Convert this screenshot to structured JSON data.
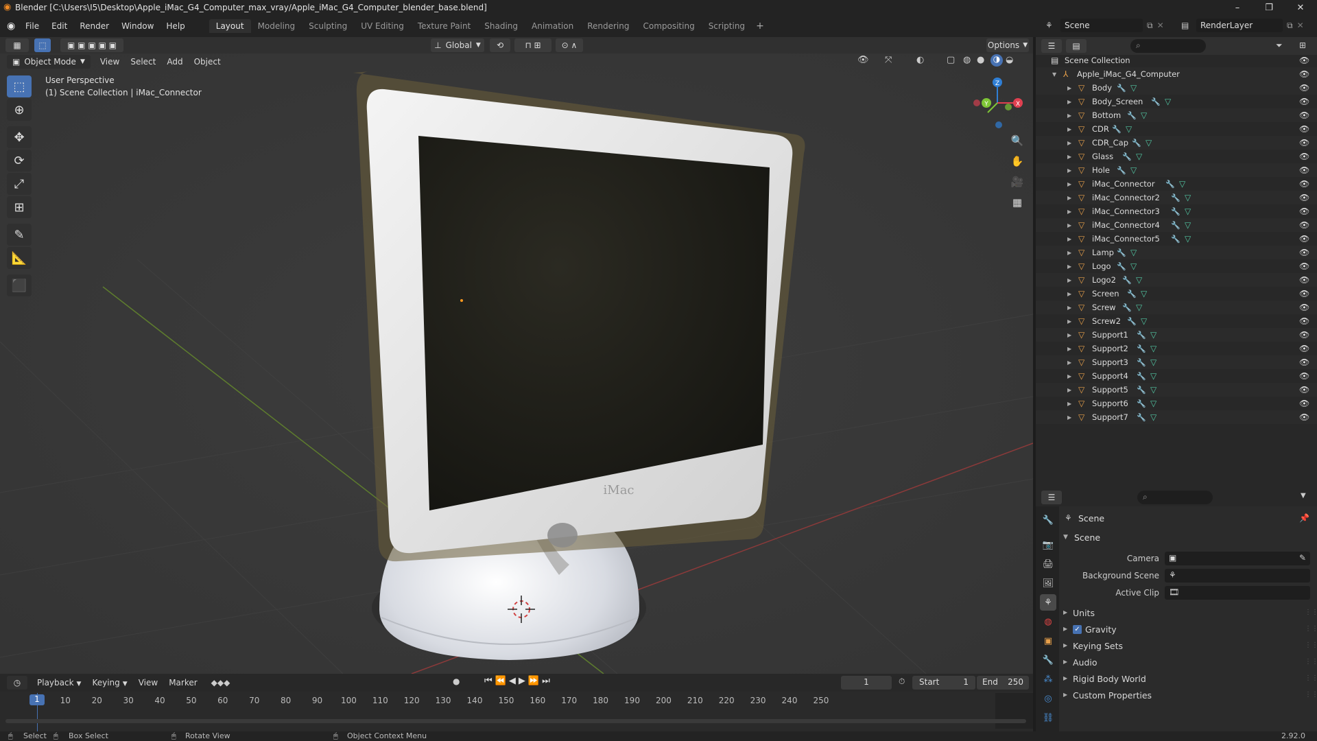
{
  "window": {
    "title": "Blender [C:\\Users\\I5\\Desktop\\Apple_iMac_G4_Computer_max_vray/Apple_iMac_G4_Computer_blender_base.blend]",
    "minimize": "–",
    "maximize": "❐",
    "close": "✕"
  },
  "menu": [
    "File",
    "Edit",
    "Render",
    "Window",
    "Help"
  ],
  "workspaces": [
    "Layout",
    "Modeling",
    "Sculpting",
    "UV Editing",
    "Texture Paint",
    "Shading",
    "Animation",
    "Rendering",
    "Compositing",
    "Scripting"
  ],
  "workspace_add": "+",
  "scene_selector": "Scene",
  "renderlayer_selector": "RenderLayer",
  "toolbar": {
    "transform_orientation": "Global",
    "options": "Options"
  },
  "viewport_header": {
    "mode": "Object Mode",
    "menus": [
      "View",
      "Select",
      "Add",
      "Object"
    ]
  },
  "viewport": {
    "perspective": "User Perspective",
    "collection_info": "(1) Scene Collection | iMac_Connector",
    "logo": "iMac",
    "gizmo": {
      "z": "Z",
      "y": "Y",
      "x": "X"
    }
  },
  "outliner": {
    "root": "Scene Collection",
    "collection": "Apple_iMac_G4_Computer",
    "items": [
      "Body",
      "Body_Screen",
      "Bottom",
      "CDR",
      "CDR_Cap",
      "Glass",
      "Hole",
      "iMac_Connector",
      "iMac_Connector2",
      "iMac_Connector3",
      "iMac_Connector4",
      "iMac_Connector5",
      "Lamp",
      "Logo",
      "Logo2",
      "Screen",
      "Screw",
      "Screw2",
      "Support1",
      "Support2",
      "Support3",
      "Support4",
      "Support5",
      "Support6",
      "Support7"
    ],
    "active_item": "iMac_Connector"
  },
  "properties": {
    "context": "Scene",
    "panel": "Scene",
    "fields": [
      {
        "label": "Camera",
        "value": ""
      },
      {
        "label": "Background Scene",
        "value": ""
      },
      {
        "label": "Active Clip",
        "value": ""
      }
    ],
    "sections": [
      "Units",
      "Gravity",
      "Keying Sets",
      "Audio",
      "Rigid Body World",
      "Custom Properties"
    ],
    "gravity_checked": true
  },
  "timeline": {
    "menus": [
      "Playback",
      "Keying",
      "View",
      "Marker"
    ],
    "current_frame": "1",
    "start_label": "Start",
    "start": "1",
    "end_label": "End",
    "end": "250",
    "ticks": [
      "10",
      "20",
      "30",
      "40",
      "50",
      "60",
      "70",
      "80",
      "90",
      "100",
      "110",
      "120",
      "130",
      "140",
      "150",
      "160",
      "170",
      "180",
      "190",
      "200",
      "210",
      "220",
      "230",
      "240",
      "250"
    ],
    "playhead": "1"
  },
  "statusbar": {
    "select": "Select",
    "box_select": "Box Select",
    "rotate_view": "Rotate View",
    "context_menu": "Object Context Menu",
    "version": "2.92.0"
  },
  "colors": {
    "accent": "#4772b3",
    "object_orange": "#e8a04a",
    "mesh_green": "#52c7a3",
    "axis_x": "#e04050",
    "axis_y": "#7ec536",
    "axis_z": "#2f7fd6"
  }
}
